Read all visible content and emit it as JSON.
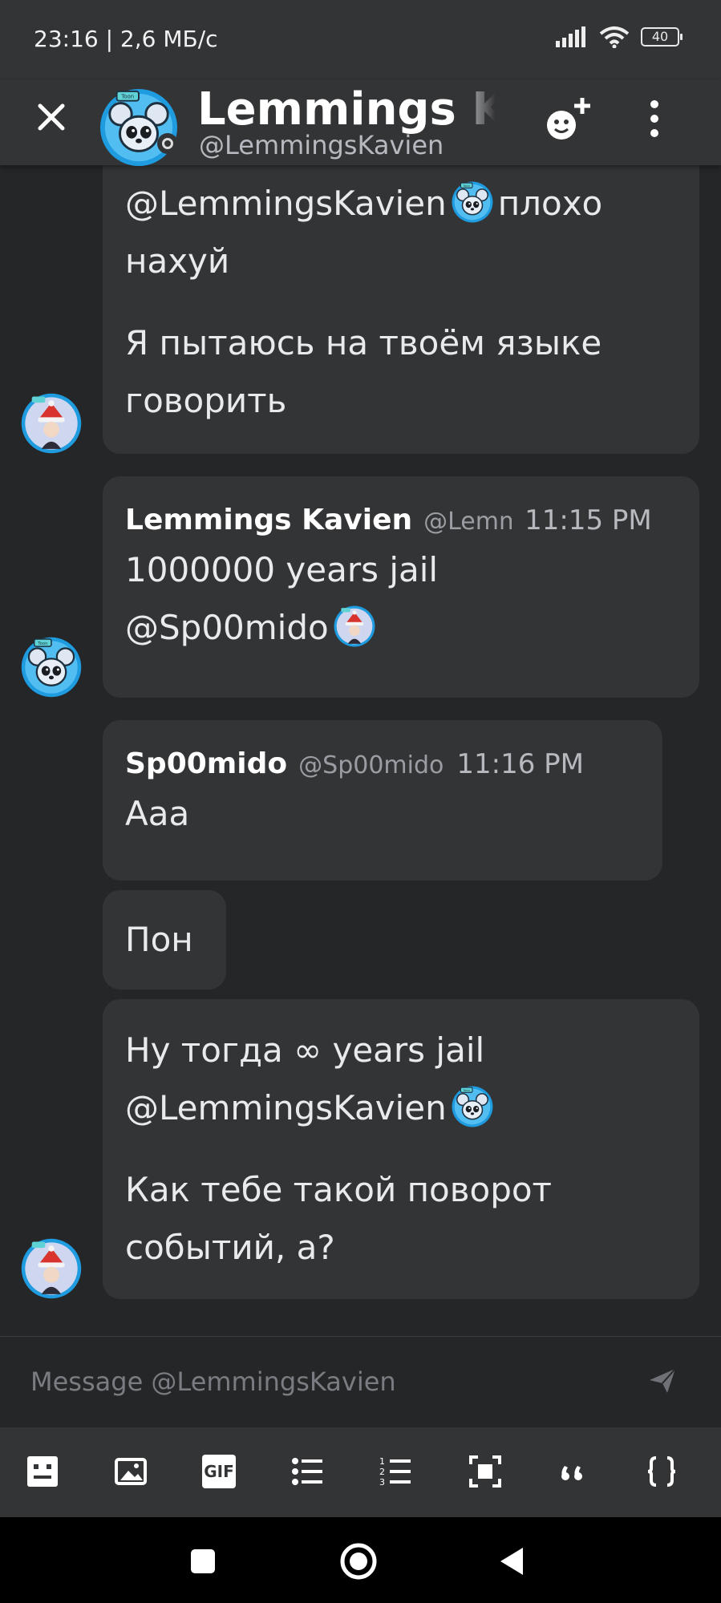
{
  "status": {
    "time": "23:16 | 2,6 МБ/с",
    "battery": "40"
  },
  "header": {
    "title": "Lemmings Kavien",
    "subtitle": "@LemmingsKavien"
  },
  "messages": {
    "m1": {
      "line1_prefix": "@LemmingsKavien",
      "line1_suffix": "плохо",
      "line2": "нахуй",
      "para2": "Я пытаюсь на твоём языке говорить"
    },
    "m2": {
      "author": "Lemmings Kavien",
      "handle": "@LemmingsKavien",
      "time": "11:15 PM",
      "line1": "1000000 years jail",
      "mention": "@Sp00mido"
    },
    "m3": {
      "author": "Sp00mido",
      "handle": "@Sp00mido",
      "time": "11:16 PM",
      "text": "Aaa"
    },
    "m4": {
      "text": "Пон"
    },
    "m5": {
      "line1": "Ну тогда ∞ years jail",
      "mention": "@LemmingsKavien",
      "para2": "Как тебе такой поворот событий, а?"
    }
  },
  "composer": {
    "placeholder": "Message @LemmingsKavien"
  },
  "toolbar": {
    "gif_label": "GIF"
  },
  "colors": {
    "accent_blue": "#2ba6e6",
    "bubble": "#333436",
    "background": "#252627"
  }
}
